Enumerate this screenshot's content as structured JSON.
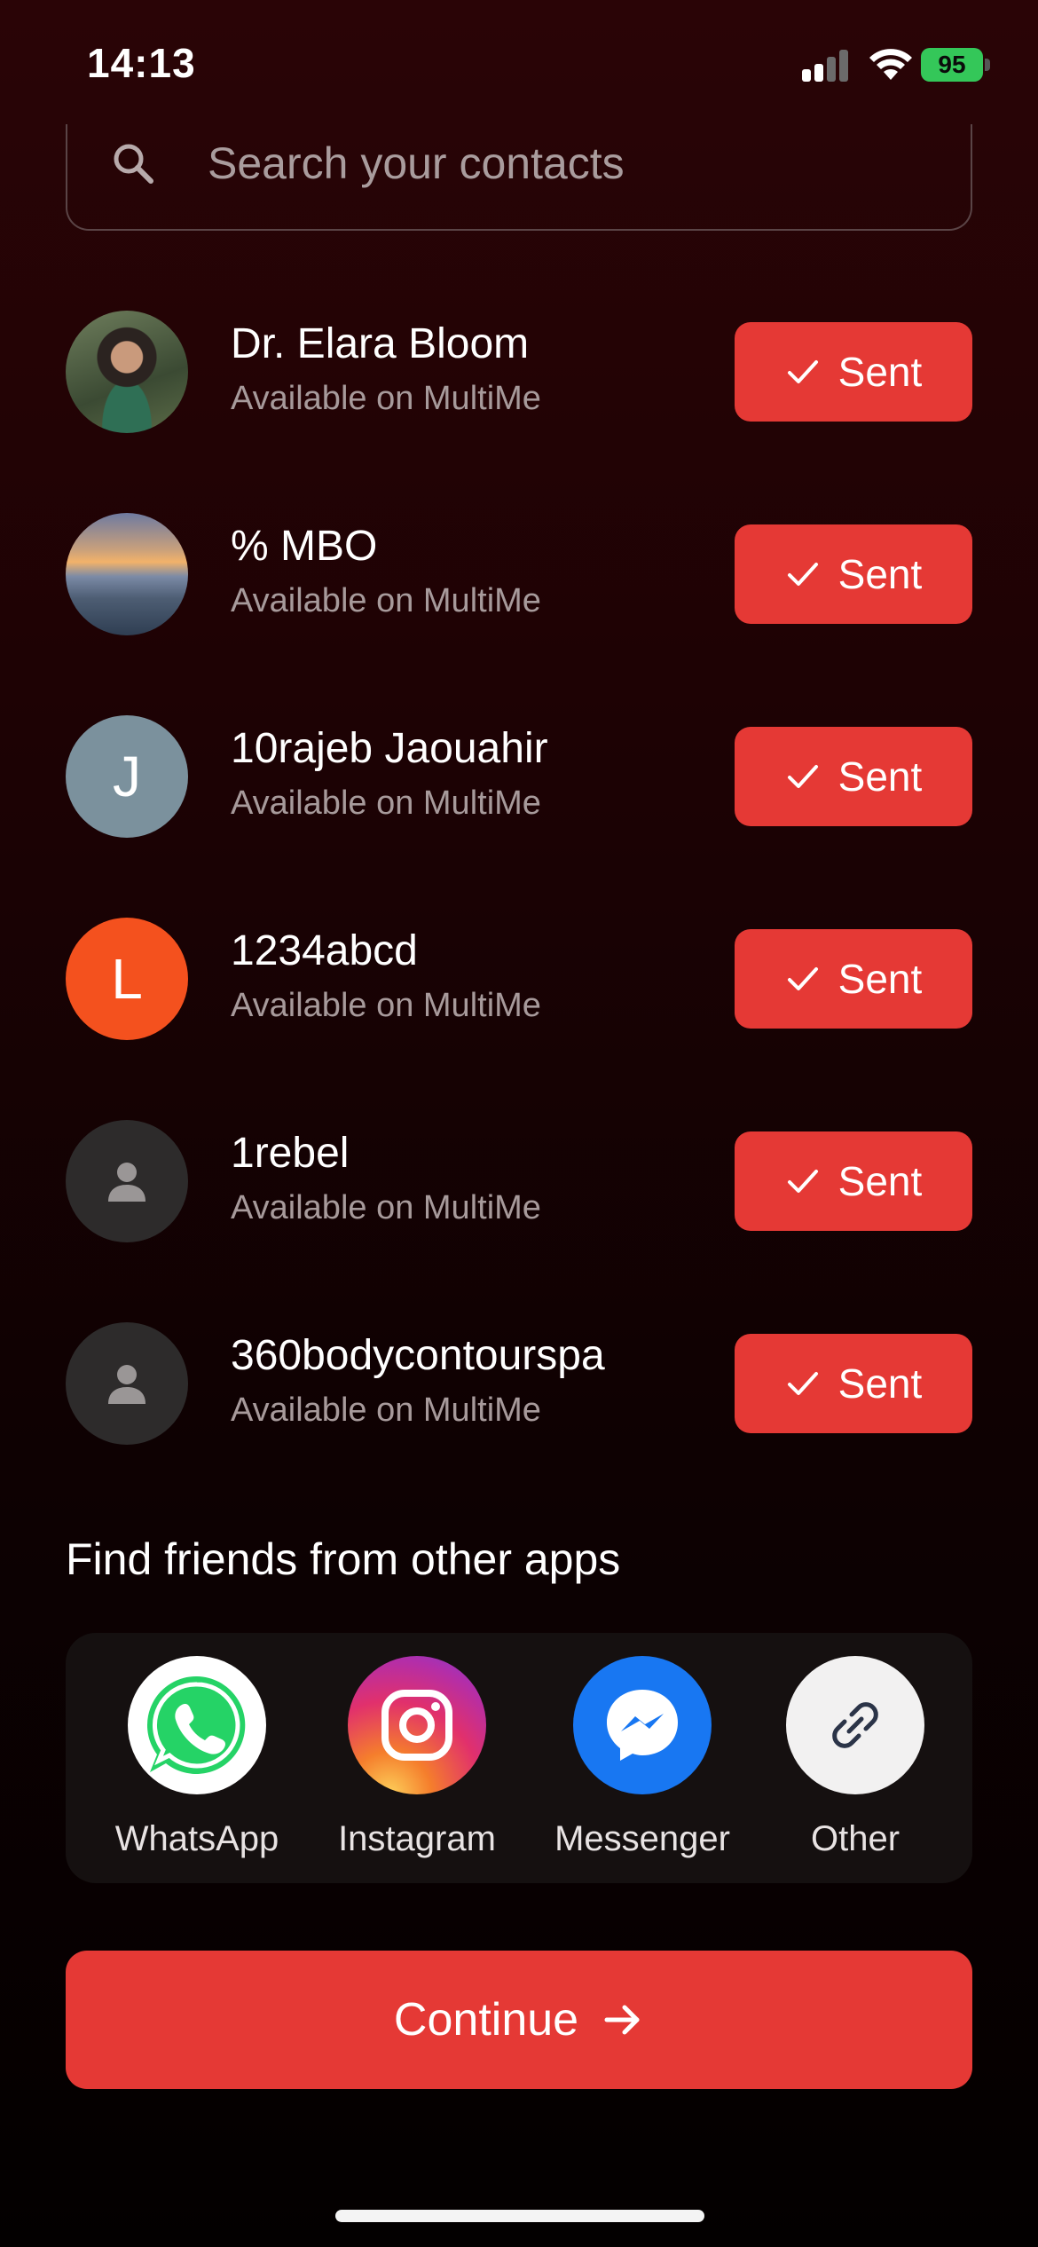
{
  "status_bar": {
    "time": "14:13",
    "battery": "95"
  },
  "search": {
    "placeholder": "Search your contacts"
  },
  "contacts": [
    {
      "name": "Dr. Elara Bloom",
      "subtitle": "Available on MultiMe",
      "button": "Sent",
      "avatar": "photo-portrait"
    },
    {
      "name": "% MBO",
      "subtitle": "Available on MultiMe",
      "button": "Sent",
      "avatar": "photo-landscape"
    },
    {
      "name": "10rajeb Jaouahir",
      "subtitle": "Available on MultiMe",
      "button": "Sent",
      "avatar": "J"
    },
    {
      "name": "1234abcd",
      "subtitle": "Available on MultiMe",
      "button": "Sent",
      "avatar": "L"
    },
    {
      "name": "1rebel",
      "subtitle": "Available on MultiMe",
      "button": "Sent",
      "avatar": "person-icon"
    },
    {
      "name": "360bodycontourspa",
      "subtitle": "Available on MultiMe",
      "button": "Sent",
      "avatar": "person-icon"
    }
  ],
  "find_friends": {
    "title": "Find friends from other apps",
    "apps": [
      {
        "label": "WhatsApp",
        "icon": "whatsapp-icon"
      },
      {
        "label": "Instagram",
        "icon": "instagram-icon"
      },
      {
        "label": "Messenger",
        "icon": "messenger-icon"
      },
      {
        "label": "Other",
        "icon": "link-icon"
      }
    ]
  },
  "continue_label": "Continue",
  "colors": {
    "accent": "#e53935",
    "background_top": "#2a0406",
    "background_bottom": "#030000",
    "secondary_text": "#a79a9b"
  }
}
